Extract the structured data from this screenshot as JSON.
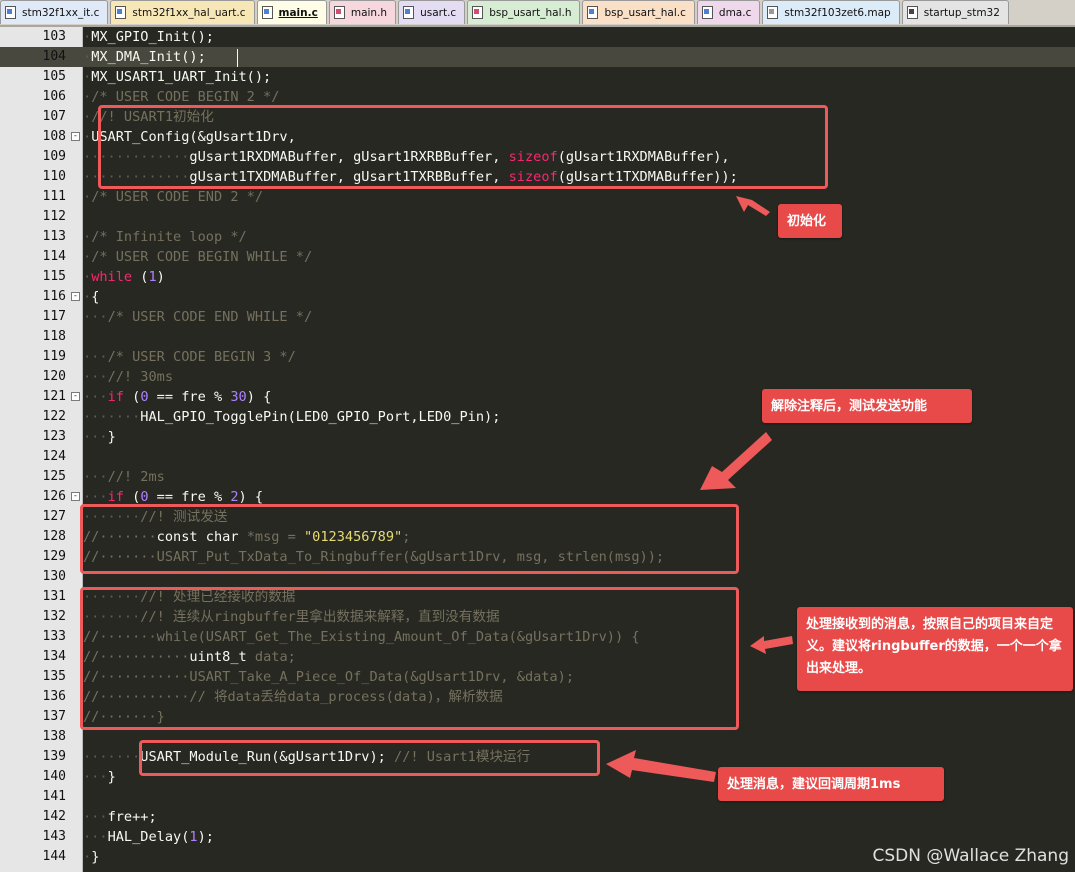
{
  "tabs": [
    {
      "label": "stm32f1xx_it.c",
      "icon": "c-file-icon",
      "bg": "#dfe9f7"
    },
    {
      "label": "stm32f1xx_hal_uart.c",
      "icon": "c-file-icon",
      "bg": "#f8e7b6"
    },
    {
      "label": "main.c",
      "icon": "c-file-icon",
      "bg": "#fffde6",
      "active": true
    },
    {
      "label": "main.h",
      "icon": "h-file-icon",
      "bg": "#f7d7de"
    },
    {
      "label": "usart.c",
      "icon": "c-file-icon",
      "bg": "#e3dcf2"
    },
    {
      "label": "bsp_usart_hal.h",
      "icon": "h-file-icon",
      "bg": "#d7edd3"
    },
    {
      "label": "bsp_usart_hal.c",
      "icon": "c-file-icon",
      "bg": "#fbe0c8"
    },
    {
      "label": "dma.c",
      "icon": "c-file-icon",
      "bg": "#efd7ec"
    },
    {
      "label": "stm32f103zet6.map",
      "icon": "map-file-icon",
      "bg": "#dcebf8"
    },
    {
      "label": "startup_stm32",
      "icon": "s-file-icon",
      "bg": "#e4e4e4"
    }
  ],
  "lines": [
    {
      "n": "103",
      "fold": false,
      "ind": "·",
      "t": [
        [
          "f",
          "MX_GPIO_Init();"
        ]
      ]
    },
    {
      "n": "104",
      "fold": false,
      "ind": "·",
      "current": true,
      "t": [
        [
          "f",
          "MX_DMA_Init();"
        ]
      ]
    },
    {
      "n": "105",
      "fold": false,
      "ind": "·",
      "t": [
        [
          "f",
          "MX_USART1_UART_Init();"
        ]
      ]
    },
    {
      "n": "106",
      "fold": false,
      "ind": "·",
      "t": [
        [
          "c",
          "/* USER CODE BEGIN 2 */"
        ]
      ]
    },
    {
      "n": "107",
      "fold": false,
      "ind": "·",
      "t": [
        [
          "c",
          "//! USART1初始化"
        ]
      ]
    },
    {
      "n": "108",
      "fold": true,
      "ind": "·",
      "t": [
        [
          "f",
          "USART_Config(&gUsart1Drv,"
        ]
      ]
    },
    {
      "n": "109",
      "fold": false,
      "ind": "·············",
      "t": [
        [
          "f",
          "gUsart1RXDMABuffer, gUsart1RXRBBuffer, "
        ],
        [
          "k",
          "sizeof"
        ],
        [
          "f",
          "(gUsart1RXDMABuffer),"
        ]
      ]
    },
    {
      "n": "110",
      "fold": false,
      "ind": "·············",
      "t": [
        [
          "f",
          "gUsart1TXDMABuffer, gUsart1TXRBBuffer, "
        ],
        [
          "k",
          "sizeof"
        ],
        [
          "f",
          "(gUsart1TXDMABuffer));"
        ]
      ]
    },
    {
      "n": "111",
      "fold": false,
      "ind": "·",
      "t": [
        [
          "c",
          "/* USER CODE END 2 */"
        ]
      ]
    },
    {
      "n": "112",
      "fold": false,
      "ind": "",
      "t": []
    },
    {
      "n": "113",
      "fold": false,
      "ind": "·",
      "t": [
        [
          "c",
          "/* Infinite loop */"
        ]
      ]
    },
    {
      "n": "114",
      "fold": false,
      "ind": "·",
      "t": [
        [
          "c",
          "/* USER CODE BEGIN WHILE */"
        ]
      ]
    },
    {
      "n": "115",
      "fold": false,
      "ind": "·",
      "t": [
        [
          "k",
          "while"
        ],
        [
          "f",
          " ("
        ],
        [
          "n",
          "1"
        ],
        [
          "f",
          ")"
        ]
      ]
    },
    {
      "n": "116",
      "fold": true,
      "ind": "·",
      "t": [
        [
          "f",
          "{"
        ]
      ]
    },
    {
      "n": "117",
      "fold": false,
      "ind": "···",
      "t": [
        [
          "c",
          "/* USER CODE END WHILE */"
        ]
      ]
    },
    {
      "n": "118",
      "fold": false,
      "ind": "",
      "t": []
    },
    {
      "n": "119",
      "fold": false,
      "ind": "···",
      "t": [
        [
          "c",
          "/* USER CODE BEGIN 3 */"
        ]
      ]
    },
    {
      "n": "120",
      "fold": false,
      "ind": "···",
      "t": [
        [
          "c",
          "//! 30ms"
        ]
      ]
    },
    {
      "n": "121",
      "fold": true,
      "ind": "···",
      "t": [
        [
          "k",
          "if"
        ],
        [
          "f",
          " ("
        ],
        [
          "n",
          "0"
        ],
        [
          "f",
          " == fre % "
        ],
        [
          "n",
          "30"
        ],
        [
          "f",
          ") {"
        ]
      ]
    },
    {
      "n": "122",
      "fold": false,
      "ind": "·······",
      "t": [
        [
          "f",
          "HAL_GPIO_TogglePin(LED0_GPIO_Port,LED0_Pin);"
        ]
      ]
    },
    {
      "n": "123",
      "fold": false,
      "ind": "···",
      "t": [
        [
          "f",
          "}"
        ]
      ]
    },
    {
      "n": "124",
      "fold": false,
      "ind": "",
      "t": []
    },
    {
      "n": "125",
      "fold": false,
      "ind": "···",
      "t": [
        [
          "c",
          "//! 2ms"
        ]
      ]
    },
    {
      "n": "126",
      "fold": true,
      "ind": "···",
      "t": [
        [
          "k",
          "if"
        ],
        [
          "f",
          " ("
        ],
        [
          "n",
          "0"
        ],
        [
          "f",
          " == fre % "
        ],
        [
          "n",
          "2"
        ],
        [
          "f",
          ") {"
        ]
      ]
    },
    {
      "n": "127",
      "fold": false,
      "ind": "·······",
      "t": [
        [
          "c",
          "//! 测试发送"
        ]
      ]
    },
    {
      "n": "128",
      "fold": false,
      "ind": "",
      "t": [
        [
          "c",
          "//·······"
        ],
        [
          "f",
          "const char "
        ],
        [
          "c",
          "*msg = "
        ],
        [
          "s",
          "\"0123456789\""
        ],
        [
          "c",
          ";"
        ]
      ]
    },
    {
      "n": "129",
      "fold": false,
      "ind": "",
      "t": [
        [
          "c",
          "//·······USART_Put_TxData_To_Ringbuffer(&gUsart1Drv, msg, strlen(msg));"
        ]
      ]
    },
    {
      "n": "130",
      "fold": false,
      "ind": "",
      "t": []
    },
    {
      "n": "131",
      "fold": false,
      "ind": "·······",
      "t": [
        [
          "c",
          "//! 处理已经接收的数据"
        ]
      ]
    },
    {
      "n": "132",
      "fold": false,
      "ind": "·······",
      "t": [
        [
          "c",
          "//! 连续从ringbuffer里拿出数据来解释，直到没有数据"
        ]
      ]
    },
    {
      "n": "133",
      "fold": false,
      "ind": "",
      "t": [
        [
          "c",
          "//·······while(USART_Get_The_Existing_Amount_Of_Data(&gUsart1Drv)) {"
        ]
      ]
    },
    {
      "n": "134",
      "fold": false,
      "ind": "",
      "t": [
        [
          "c",
          "//···········"
        ],
        [
          "f",
          "uint8_t "
        ],
        [
          "c",
          "data;"
        ]
      ]
    },
    {
      "n": "135",
      "fold": false,
      "ind": "",
      "t": [
        [
          "c",
          "//···········USART_Take_A_Piece_Of_Data(&gUsart1Drv, &data);"
        ]
      ]
    },
    {
      "n": "136",
      "fold": false,
      "ind": "",
      "t": [
        [
          "c",
          "//···········// 将data丢给data_process(data)，解析数据"
        ]
      ]
    },
    {
      "n": "137",
      "fold": false,
      "ind": "",
      "t": [
        [
          "c",
          "//·······}"
        ]
      ]
    },
    {
      "n": "138",
      "fold": false,
      "ind": "",
      "t": []
    },
    {
      "n": "139",
      "fold": false,
      "ind": "·······",
      "t": [
        [
          "f",
          "USART_Module_Run(&gUsart1Drv); "
        ],
        [
          "c",
          "//! Usart1模块运行"
        ]
      ]
    },
    {
      "n": "140",
      "fold": false,
      "ind": "···",
      "t": [
        [
          "f",
          "}"
        ]
      ]
    },
    {
      "n": "141",
      "fold": false,
      "ind": "",
      "t": []
    },
    {
      "n": "142",
      "fold": false,
      "ind": "···",
      "t": [
        [
          "f",
          "fre++;"
        ]
      ]
    },
    {
      "n": "143",
      "fold": false,
      "ind": "···",
      "t": [
        [
          "f",
          "HAL_Delay("
        ],
        [
          "n",
          "1"
        ],
        [
          "f",
          ");"
        ]
      ]
    },
    {
      "n": "144",
      "fold": false,
      "ind": "·",
      "t": [
        [
          "f",
          "}"
        ]
      ]
    }
  ],
  "callouts": {
    "init": "初始化",
    "send_test": "解除注释后，测试发送功能",
    "process_data": "处理接收到的消息，按照自己的项目来自定义。建议将ringbuffer的数据，一个一个拿出来处理。",
    "process_msg": "处理消息，建议回调周期1ms"
  },
  "watermark": "CSDN @Wallace Zhang",
  "colors": {
    "editor_bg": "#272822",
    "annotation": "#ee5a5a",
    "callout_bg": "#e84a4a",
    "comment": "#75715e",
    "keyword": "#f92672",
    "number": "#ae81ff",
    "string": "#e6db74"
  }
}
